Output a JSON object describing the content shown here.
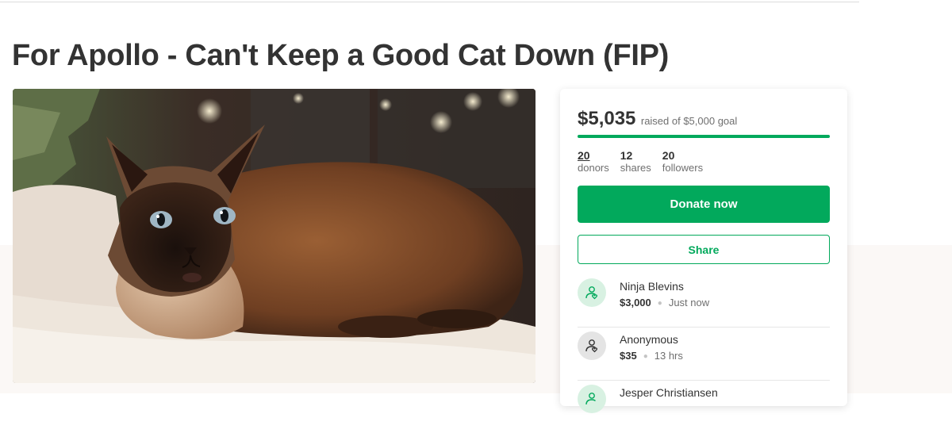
{
  "campaign": {
    "title": "For Apollo - Can't Keep a Good Cat Down (FIP)",
    "raised": "$5,035",
    "goal_text": "raised of $5,000 goal",
    "progress_fraction": 1.0
  },
  "stats": [
    {
      "value": "20",
      "label": "donors"
    },
    {
      "value": "12",
      "label": "shares"
    },
    {
      "value": "20",
      "label": "followers"
    }
  ],
  "buttons": {
    "donate": "Donate now",
    "share": "Share"
  },
  "donations": [
    {
      "name": "Ninja Blevins",
      "amount": "$3,000",
      "time": "Just now"
    },
    {
      "name": "Anonymous",
      "amount": "$35",
      "time": "13 hrs"
    },
    {
      "name": "Jesper Christiansen",
      "amount": "",
      "time": ""
    }
  ],
  "colors": {
    "brand_green": "#02a95c",
    "avatar_green": "#d8f1e2",
    "avatar_grey": "#e4e4e4"
  },
  "icons": {
    "donor_avatar": "hand-heart-icon"
  }
}
